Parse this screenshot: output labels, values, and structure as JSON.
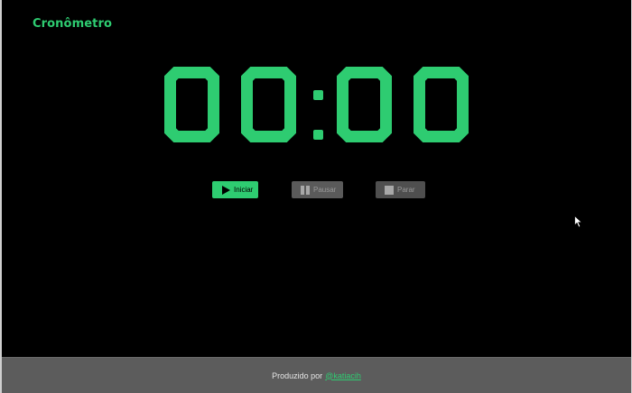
{
  "app": {
    "title": "Cronômetro",
    "accent_color": "#2ecc71"
  },
  "timer": {
    "minutes": "00",
    "seconds": "00",
    "separator": ":"
  },
  "controls": {
    "start": {
      "label": "Iniciar",
      "icon": "play-icon",
      "enabled": true
    },
    "pause": {
      "label": "Pausar",
      "icon": "pause-icon",
      "enabled": false
    },
    "stop": {
      "label": "Parar",
      "icon": "stop-icon",
      "enabled": false
    }
  },
  "footer": {
    "text": "Produzido por",
    "link_text": "@katiacih"
  }
}
